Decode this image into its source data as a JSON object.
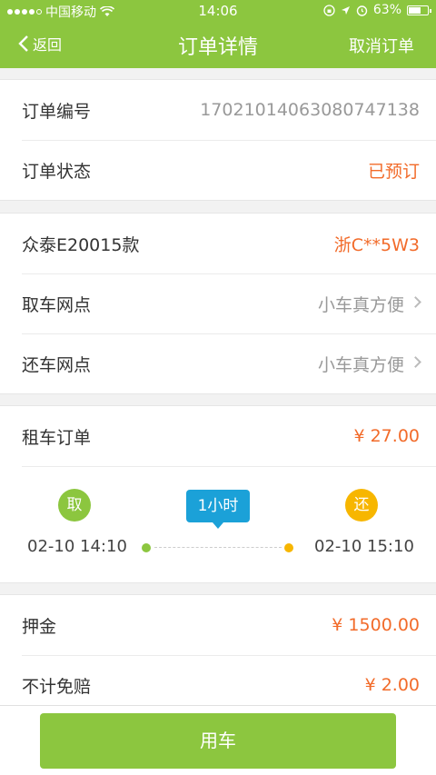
{
  "status_bar": {
    "carrier": "中国移动",
    "time": "14:06",
    "battery": "63%",
    "battery_level": 0.63,
    "icons": [
      "signal-dots",
      "wifi-icon",
      "lock-rotation-icon",
      "location-icon",
      "alarm-icon",
      "battery-icon"
    ]
  },
  "nav": {
    "back_label": "返回",
    "title": "订单详情",
    "cancel_label": "取消订单"
  },
  "order_info": {
    "number_label": "订单编号",
    "number_value": "17021014063080747138",
    "status_label": "订单状态",
    "status_value": "已预订"
  },
  "vehicle": {
    "model": "众泰E20015款",
    "plate": "浙C**5W3",
    "pickup_label": "取车网点",
    "pickup_value": "小车真方便",
    "return_label": "还车网点",
    "return_value": "小车真方便"
  },
  "rental": {
    "label": "租车订单",
    "price": "¥ 27.00",
    "pickup_badge": "取",
    "return_badge": "还",
    "duration": "1小时",
    "start_time": "02-10 14:10",
    "end_time": "02-10 15:10"
  },
  "fees": {
    "deposit_label": "押金",
    "deposit_value": "¥ 1500.00",
    "insurance_label": "不计免赔",
    "insurance_value": "¥ 2.00"
  },
  "action": {
    "use_car_label": "用车"
  },
  "colors": {
    "brand_green": "#8cc63f",
    "accent_orange": "#f26b2a",
    "duration_blue": "#1ba1d8",
    "return_yellow": "#f7b600"
  }
}
